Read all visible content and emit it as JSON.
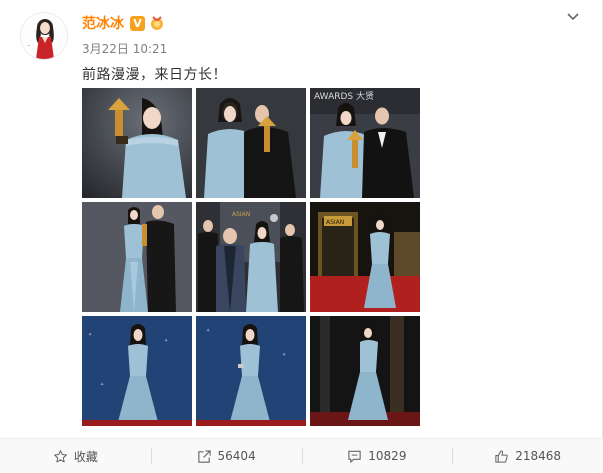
{
  "post": {
    "author": "范冰冰",
    "vip_badge": "V",
    "time": "3月22日 10:21",
    "text": "前路漫漫，来日方长！"
  },
  "footer": {
    "favorite_label": "收藏",
    "repost_count": "56404",
    "comment_count": "10829",
    "like_count": "218468"
  },
  "photos": [
    {
      "scene": "gown-trophy-dark",
      "sign": ""
    },
    {
      "scene": "gown-with-man-black",
      "sign": ""
    },
    {
      "scene": "gown-with-man-tux-awards",
      "sign": "AWARDS 大贤"
    },
    {
      "scene": "full-gown-with-man",
      "sign": ""
    },
    {
      "scene": "group-backdrop",
      "sign": ""
    },
    {
      "scene": "red-carpet-gold-arch",
      "sign": "ASIAN"
    },
    {
      "scene": "full-gown-blue-backdrop",
      "sign": ""
    },
    {
      "scene": "full-gown-blue-backdrop-2",
      "sign": ""
    },
    {
      "scene": "full-gown-blue-backdrop-3",
      "sign": ""
    }
  ],
  "colors": {
    "author": "#ff8200",
    "gown": "#9fc1d6",
    "carpet": "#b0201e",
    "backdrop_blue": "#1b3a6b"
  },
  "icons": [
    "chevron-down-icon",
    "favorite-icon",
    "repost-icon",
    "comment-icon",
    "like-icon",
    "vip-icon",
    "medal-icon"
  ]
}
